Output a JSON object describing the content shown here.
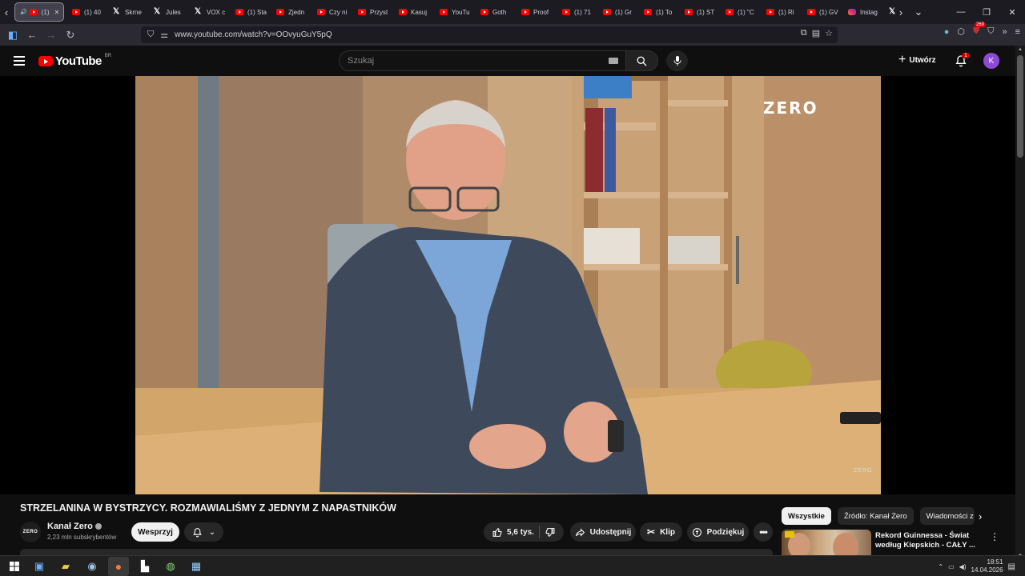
{
  "browser": {
    "tabs": [
      {
        "label": "(1) ",
        "favicon": "youtube",
        "active": true
      },
      {
        "label": "(1) 40",
        "favicon": "youtube"
      },
      {
        "label": "Skrne",
        "favicon": "x"
      },
      {
        "label": "Jules",
        "favicon": "x"
      },
      {
        "label": "VOX c",
        "favicon": "x"
      },
      {
        "label": "(1) Sta",
        "favicon": "youtube"
      },
      {
        "label": "Zjedn",
        "favicon": "youtube"
      },
      {
        "label": "Czy ni",
        "favicon": "youtube"
      },
      {
        "label": "Przyst",
        "favicon": "youtube"
      },
      {
        "label": "Kasuj",
        "favicon": "youtube"
      },
      {
        "label": "YouTu",
        "favicon": "youtube"
      },
      {
        "label": "Goth",
        "favicon": "youtube"
      },
      {
        "label": "Proof",
        "favicon": "youtube"
      },
      {
        "label": "(1) 71",
        "favicon": "youtube"
      },
      {
        "label": "(1) Gr",
        "favicon": "youtube"
      },
      {
        "label": "(1) To",
        "favicon": "youtube"
      },
      {
        "label": "(1) ST",
        "favicon": "youtube"
      },
      {
        "label": "(1) \"C",
        "favicon": "youtube"
      },
      {
        "label": "(1) Ri",
        "favicon": "youtube"
      },
      {
        "label": "(1) GV",
        "favicon": "youtube"
      },
      {
        "label": "Instag",
        "favicon": "instagram"
      }
    ],
    "url": "www.youtube.com/watch?v=OOvyuGuY5pQ",
    "extension_badge": "269"
  },
  "youtube": {
    "logo_text": "YouTube",
    "region": "BR",
    "search_placeholder": "Szukaj",
    "create_label": "Utwórz",
    "notification_count": "1",
    "avatar_letter": "K",
    "video_watermark": "ZERO",
    "video_corner_mark": "ZERO",
    "title": "STRZELANINA W BYSTRZYCY. ROZMAWIALIŚMY Z JEDNYM Z NAPASTNIKÓW",
    "channel": {
      "name": "Kanał Zero",
      "avatar_text": "ZERO",
      "subscribers": "2,23 mln subskrybentów",
      "support_label": "Wesprzyj"
    },
    "actions": {
      "likes": "5,6 tys.",
      "share": "Udostępnij",
      "clip": "Klip",
      "thanks": "Podziękuj"
    },
    "chips": [
      "Wszystkie",
      "Źródło: Kanał Zero",
      "Wiadomości z"
    ],
    "recommendation": {
      "title_line1": "Rekord Guinnessa - Świat",
      "title_line2": "według Kiepskich - CAŁY ..."
    }
  },
  "taskbar": {
    "time": "18:51",
    "date": "14.04.2026"
  },
  "colors": {
    "youtube_red": "#ff0000",
    "avatar_purple": "#8c4bd6",
    "background": "#0f0f0f"
  }
}
